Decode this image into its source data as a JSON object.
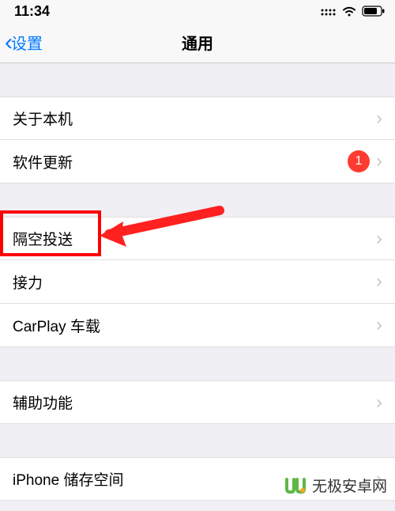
{
  "status_bar": {
    "time": "11:34"
  },
  "nav": {
    "back_label": "设置",
    "title": "通用"
  },
  "groups": [
    {
      "rows": [
        {
          "key": "about",
          "label": "关于本机",
          "badge": null
        },
        {
          "key": "software-update",
          "label": "软件更新",
          "badge": "1"
        }
      ]
    },
    {
      "rows": [
        {
          "key": "airdrop",
          "label": "隔空投送",
          "badge": null
        },
        {
          "key": "handoff",
          "label": "接力",
          "badge": null
        },
        {
          "key": "carplay",
          "label": "CarPlay 车载",
          "badge": null
        }
      ]
    },
    {
      "rows": [
        {
          "key": "accessibility",
          "label": "辅助功能",
          "badge": null
        }
      ]
    },
    {
      "rows": [
        {
          "key": "iphone-storage",
          "label": "iPhone 储存空间",
          "badge": null
        }
      ]
    }
  ],
  "watermark": {
    "text": "无极安卓网"
  }
}
